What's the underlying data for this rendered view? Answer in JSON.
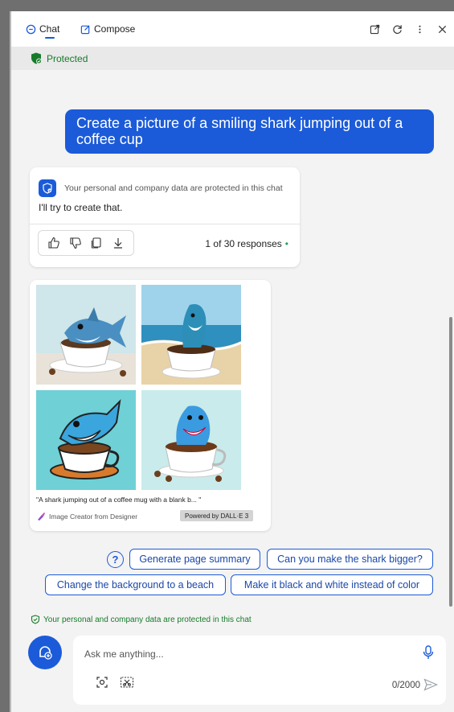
{
  "tabs": {
    "chat": "Chat",
    "compose": "Compose"
  },
  "protected_label": "Protected",
  "user_message": "Create a picture of a smiling shark jumping out of a coffee cup",
  "response": {
    "privacy_notice": "Your personal and company data are protected in this chat",
    "reply": "I'll try to create that.",
    "count": "1 of 30 responses",
    "dot": "•"
  },
  "image_result": {
    "caption": "\"A shark jumping out of a coffee mug with a blank b... \"",
    "credit": "Image Creator from Designer",
    "powered_by": "Powered by DALL·E 3"
  },
  "suggestions": [
    "Generate page summary",
    "Can you make the shark bigger?",
    "Change the background to a beach",
    "Make it black and white instead of color"
  ],
  "footer_notice": "Your personal and company data are protected in this chat",
  "input": {
    "placeholder": "Ask me anything...",
    "counter": "0/2000"
  },
  "colors": {
    "accent": "#1b5bd9",
    "protected_green": "#177a2a",
    "panel_bg": "#f3f3f3"
  }
}
